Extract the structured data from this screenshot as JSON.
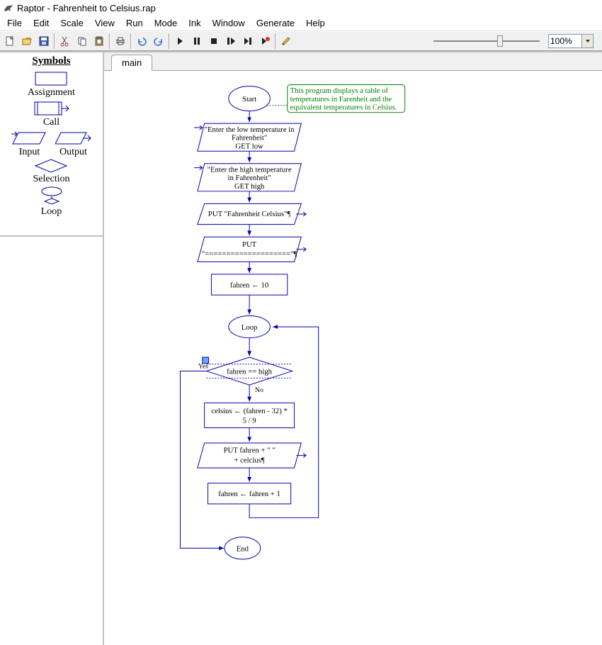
{
  "window": {
    "title": "Raptor - Fahrenheit to Celsius.rap"
  },
  "menu": [
    "File",
    "Edit",
    "Scale",
    "View",
    "Run",
    "Mode",
    "Ink",
    "Window",
    "Generate",
    "Help"
  ],
  "toolbar": {
    "icons": [
      "new",
      "open",
      "save",
      "cut",
      "copy",
      "paste",
      "print",
      "undo",
      "redo",
      "play",
      "pause",
      "stop",
      "step-into",
      "step-over",
      "breakpoint",
      "pencil"
    ],
    "zoom_value": "100%"
  },
  "symbols": {
    "title": "Symbols",
    "assignment": "Assignment",
    "call": "Call",
    "input": "Input",
    "output": "Output",
    "selection": "Selection",
    "loop": "Loop"
  },
  "tabs": {
    "main": "main"
  },
  "flow": {
    "start": "Start",
    "end": "End",
    "loop": "Loop",
    "yes": "Yes",
    "no": "No",
    "comment_l1": "This program displays a table of",
    "comment_l2": "temperatures in Farenheit and the",
    "comment_l3": "equivalent temperatures in Celsius.",
    "in_low_l1": "\"Enter the low temperature in",
    "in_low_l2": "Fahrenheit\"",
    "in_low_l3": "GET low",
    "in_high_l1": "\"Enter the high temperature",
    "in_high_l2": "in Fahrenheit\"",
    "in_high_l3": "GET high",
    "out_hdr": "PUT \"Fahrenheit   Celsius\"¶",
    "out_sep_l1": "PUT",
    "out_sep_l2": "\"====================\"¶",
    "assign_init": "fahren ← 10",
    "cond": "fahren == high",
    "calc_l1": "celsius ← (fahren  - 32) *",
    "calc_l2": "5  /  9",
    "out_row_l1": "PUT fahren  +  \"               \"",
    "out_row_l2": "+  celcius¶",
    "incr": "fahren ← fahren  +  1"
  },
  "chart_data": {
    "type": "flowchart",
    "nodes": [
      {
        "id": "start",
        "kind": "terminator",
        "label": "Start"
      },
      {
        "id": "comment",
        "kind": "comment",
        "text": "This program displays a table of temperatures in Farenheit and the equivalent temperatures in Celsius."
      },
      {
        "id": "in_low",
        "kind": "input",
        "prompt": "Enter the low temperature in Fahrenheit",
        "var": "low"
      },
      {
        "id": "in_high",
        "kind": "input",
        "prompt": "Enter the high temperature in Fahrenheit",
        "var": "high"
      },
      {
        "id": "out_hdr",
        "kind": "output",
        "expr": "\"Fahrenheit   Celsius\""
      },
      {
        "id": "out_sep",
        "kind": "output",
        "expr": "\"====================\""
      },
      {
        "id": "assign_init",
        "kind": "assignment",
        "expr": "fahren ← 10"
      },
      {
        "id": "loop",
        "kind": "loop"
      },
      {
        "id": "cond",
        "kind": "decision",
        "expr": "fahren == high"
      },
      {
        "id": "calc",
        "kind": "assignment",
        "expr": "celsius ← (fahren - 32) * 5 / 9"
      },
      {
        "id": "out_row",
        "kind": "output",
        "expr": "fahren + \"               \" + celcius"
      },
      {
        "id": "incr",
        "kind": "assignment",
        "expr": "fahren ← fahren + 1"
      },
      {
        "id": "end",
        "kind": "terminator",
        "label": "End"
      }
    ],
    "edges": [
      {
        "from": "start",
        "to": "in_low"
      },
      {
        "from": "in_low",
        "to": "in_high"
      },
      {
        "from": "in_high",
        "to": "out_hdr"
      },
      {
        "from": "out_hdr",
        "to": "out_sep"
      },
      {
        "from": "out_sep",
        "to": "assign_init"
      },
      {
        "from": "assign_init",
        "to": "loop"
      },
      {
        "from": "loop",
        "to": "cond"
      },
      {
        "from": "cond",
        "to": "calc",
        "label": "No"
      },
      {
        "from": "calc",
        "to": "out_row"
      },
      {
        "from": "out_row",
        "to": "incr"
      },
      {
        "from": "incr",
        "to": "loop",
        "back": true
      },
      {
        "from": "cond",
        "to": "end",
        "label": "Yes"
      }
    ]
  }
}
